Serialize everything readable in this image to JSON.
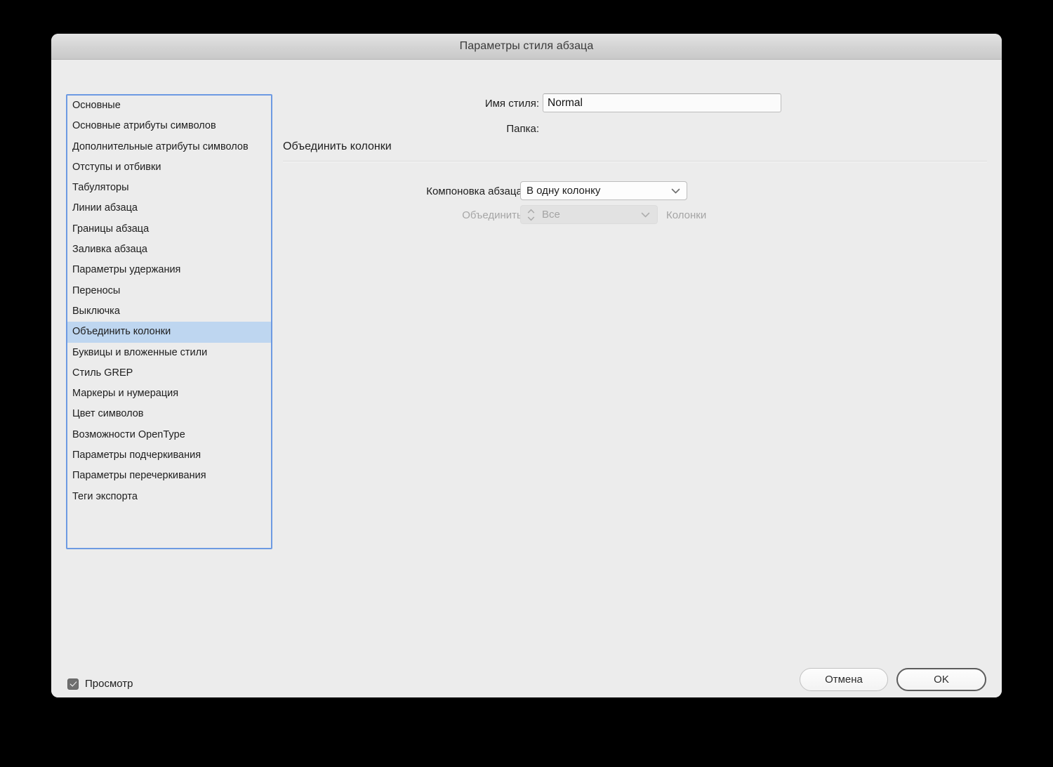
{
  "window": {
    "title": "Параметры стиля абзаца"
  },
  "sidebar": {
    "name": "category-list",
    "selected_index": 11,
    "items": [
      {
        "label": "Основные"
      },
      {
        "label": "Основные атрибуты символов"
      },
      {
        "label": "Дополнительные атрибуты символов"
      },
      {
        "label": "Отступы и отбивки"
      },
      {
        "label": "Табуляторы"
      },
      {
        "label": "Линии абзаца"
      },
      {
        "label": "Границы абзаца"
      },
      {
        "label": "Заливка абзаца"
      },
      {
        "label": "Параметры удержания"
      },
      {
        "label": "Переносы"
      },
      {
        "label": "Выключка"
      },
      {
        "label": "Объединить колонки"
      },
      {
        "label": "Буквицы и вложенные стили"
      },
      {
        "label": "Стиль GREP"
      },
      {
        "label": "Маркеры и нумерация"
      },
      {
        "label": "Цвет символов"
      },
      {
        "label": "Возможности OpenType"
      },
      {
        "label": "Параметры подчеркивания"
      },
      {
        "label": "Параметры перечеркивания"
      },
      {
        "label": "Теги экспорта"
      }
    ]
  },
  "header": {
    "style_name_label": "Имя стиля:",
    "style_name_value": "Normal",
    "style_name_placeholder": "Имя стиля",
    "folder_label": "Папка:",
    "folder_value": ""
  },
  "section": {
    "heading": "Объединить колонки",
    "paragraph_layout_label": "Компоновка абзаца:",
    "paragraph_layout_value": "В одну колонку",
    "span_label": "Объединить:",
    "span_value": "Все",
    "columns_suffix": "Колонки"
  },
  "footer": {
    "preview_label": "Просмотр",
    "preview_checked": true,
    "cancel_label": "Отмена",
    "ok_label": "OK"
  },
  "colors": {
    "window_bg": "#ececec",
    "titlebar_bg": "#d4d4d4",
    "selection_blue": "#bed6f0",
    "focus_border_blue": "#6d9ae2",
    "disabled_text": "#a4a4a4",
    "text": "#1d1d1d"
  }
}
